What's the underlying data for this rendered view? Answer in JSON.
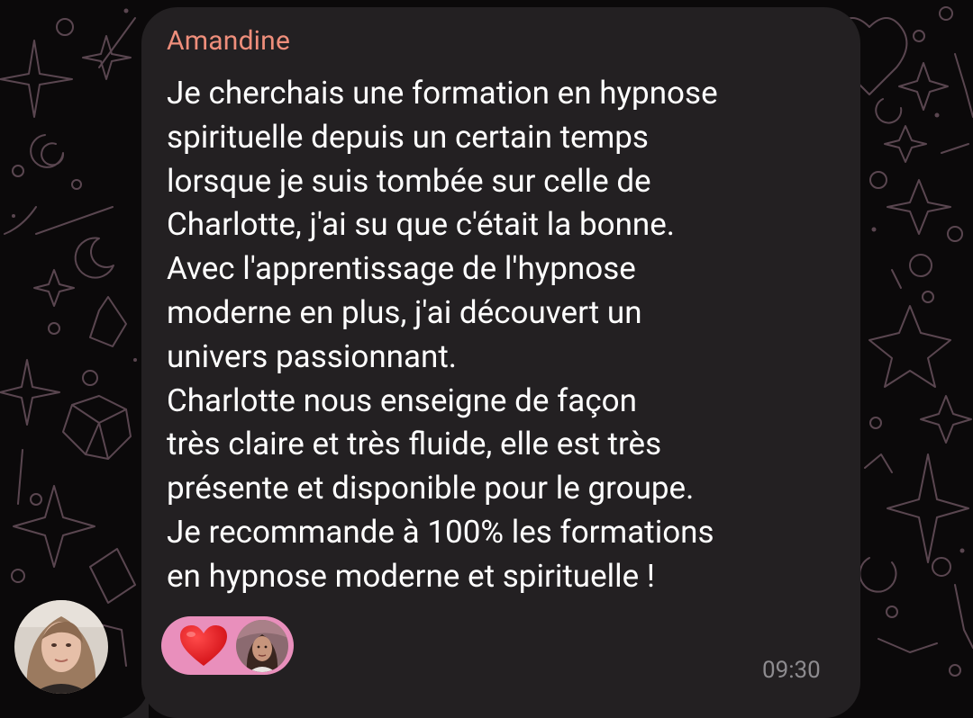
{
  "message": {
    "sender": "Amandine",
    "lines": [
      "Je cherchais une formation en hypnose",
      "spirituelle depuis un certain temps",
      "lorsque je suis tombée sur celle de",
      "Charlotte, j'ai su que c'était la bonne.",
      "Avec l'apprentissage de l'hypnose",
      "moderne en plus, j'ai découvert un",
      "univers passionnant.",
      "Charlotte nous enseigne de façon",
      "très claire et très fluide, elle est très",
      "présente et disponible pour le groupe.",
      "Je recommande à 100% les formations",
      "en hypnose moderne et spirituelle !"
    ],
    "time": "09:30"
  },
  "reaction": {
    "emoji_icon": "red-heart-icon",
    "reactor_avatar": "reactor-avatar"
  },
  "colors": {
    "background": "#0b090a",
    "bubble": "#232022",
    "sender_name": "#ef8e7b",
    "text": "#ffffff",
    "time": "#8d8b8f",
    "reaction_pill": "#e98fbc",
    "pattern": "#5a4650"
  }
}
